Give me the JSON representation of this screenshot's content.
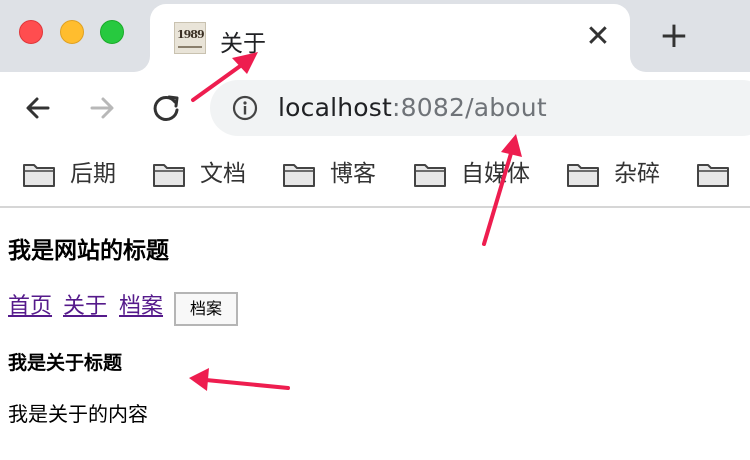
{
  "window": {
    "controls": [
      "close",
      "minimize",
      "zoom"
    ]
  },
  "tab": {
    "favicon_text": "1989",
    "title": "关于",
    "close_glyph": "✕",
    "new_tab_glyph": "+"
  },
  "toolbar": {
    "back_icon": "arrow-left-icon",
    "forward_icon": "arrow-right-icon",
    "reload_icon": "reload-icon",
    "url_host": "localhost",
    "url_path": ":8082/about",
    "info_icon": "info-icon"
  },
  "bookmarks": [
    {
      "label": "后期"
    },
    {
      "label": "文档"
    },
    {
      "label": "博客"
    },
    {
      "label": "自媒体"
    },
    {
      "label": "杂碎"
    },
    {
      "label": ""
    }
  ],
  "page": {
    "site_title": "我是网站的标题",
    "nav_links": [
      "首页",
      "关于",
      "档案"
    ],
    "archive_button": "档案",
    "about_title": "我是关于标题",
    "about_text": "我是关于的内容"
  },
  "colors": {
    "tabstrip_bg": "#dee1e6",
    "annotation_arrow": "#ee1d4f",
    "visited_link": "#551a8b"
  }
}
